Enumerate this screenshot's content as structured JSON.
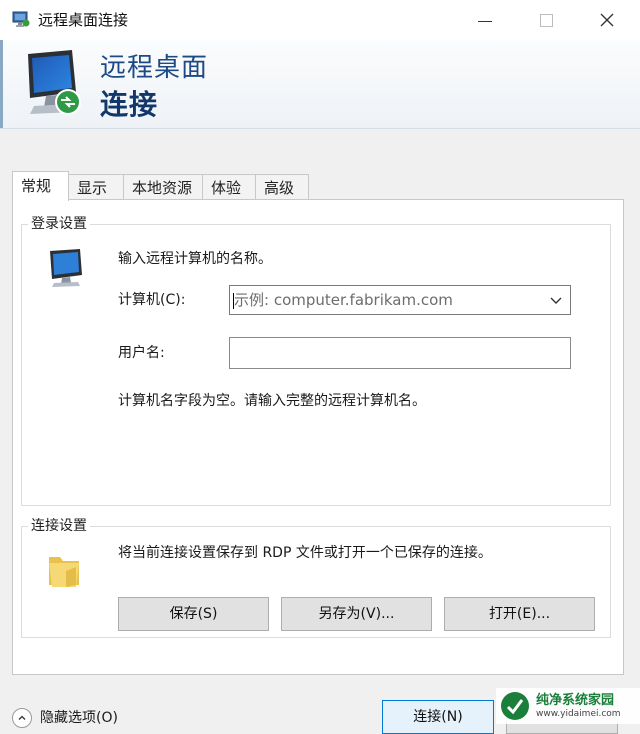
{
  "window": {
    "title": "远程桌面连接"
  },
  "banner": {
    "line1": "远程桌面",
    "line2": "连接"
  },
  "tabs": [
    {
      "label": "常规",
      "active": true
    },
    {
      "label": "显示",
      "active": false
    },
    {
      "label": "本地资源",
      "active": false
    },
    {
      "label": "体验",
      "active": false
    },
    {
      "label": "高级",
      "active": false
    }
  ],
  "login_settings": {
    "legend": "登录设置",
    "instruction": "输入远程计算机的名称。",
    "computer_label": "计算机(C):",
    "computer_placeholder": "示例: computer.fabrikam.com",
    "computer_value": "",
    "username_label": "用户名:",
    "username_value": "",
    "empty_message": "计算机名字段为空。请输入完整的远程计算机名。"
  },
  "connection_settings": {
    "legend": "连接设置",
    "description": "将当前连接设置保存到 RDP 文件或打开一个已保存的连接。",
    "save_label": "保存(S)",
    "save_as_label": "另存为(V)...",
    "open_label": "打开(E)..."
  },
  "footer": {
    "hide_options_label": "隐藏选项(O)",
    "connect_label": "连接(N)",
    "help_label": ""
  },
  "watermark": {
    "text": "纯净系统家园",
    "url": "www.yidaimei.com"
  },
  "colors": {
    "banner_title": "#1d4a86",
    "primary_button_border": "#0078d7",
    "watermark_green": "#1b7f3b"
  },
  "icons": {
    "app": "remote-desktop-icon",
    "minimize": "minimize-icon",
    "maximize": "maximize-icon",
    "close": "close-icon",
    "computer": "computer-monitor-icon",
    "folder": "folder-icon",
    "dropdown": "chevron-down-icon",
    "toggle": "chevron-up-icon"
  }
}
